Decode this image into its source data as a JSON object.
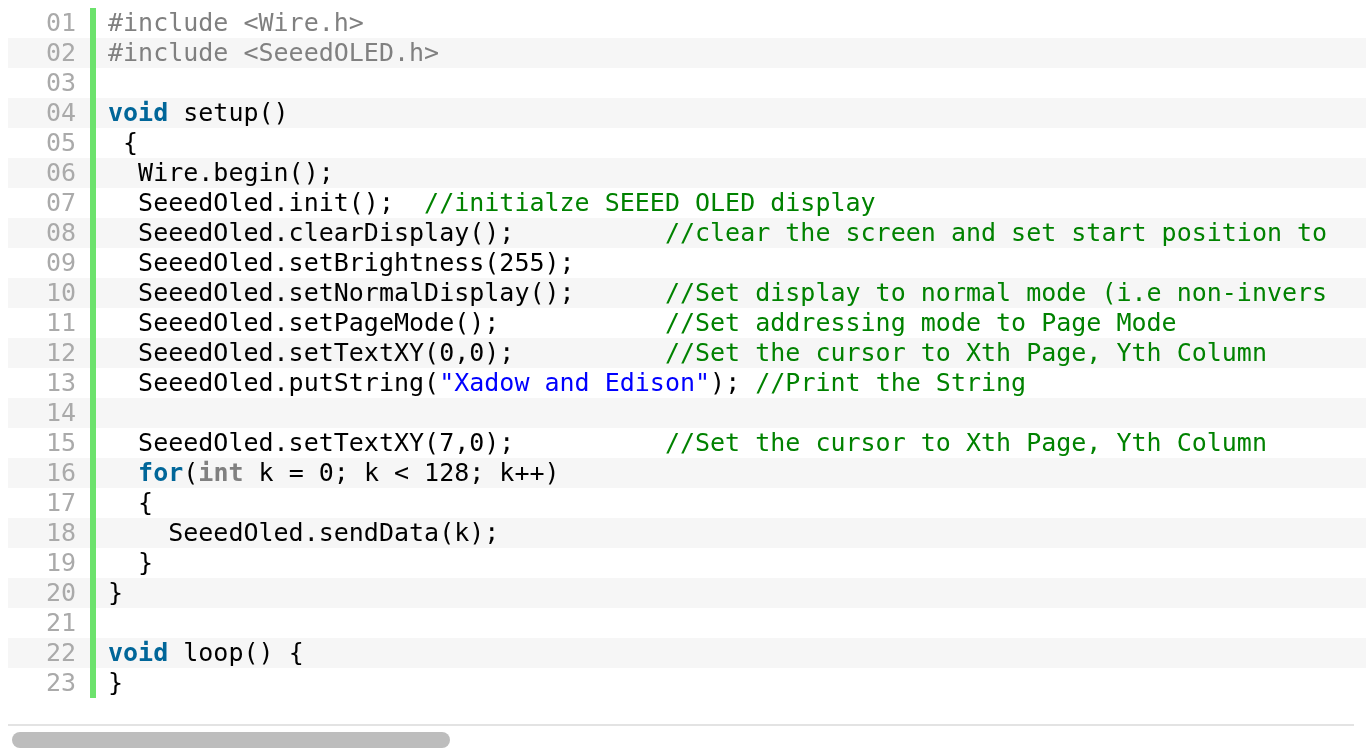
{
  "code_lines": [
    {
      "number": "01",
      "tokens": [
        {
          "kind": "preproc",
          "text": "#include <Wire.h>"
        }
      ]
    },
    {
      "number": "02",
      "tokens": [
        {
          "kind": "preproc",
          "text": "#include <SeeedOLED.h>"
        }
      ]
    },
    {
      "number": "03"
    },
    {
      "number": "04",
      "tokens": [
        {
          "kind": "keyword",
          "text": "void"
        },
        {
          "kind": "plain",
          "text": " setup()"
        }
      ]
    },
    {
      "number": "05",
      "tokens": [
        {
          "kind": "plain",
          "text": " {"
        }
      ]
    },
    {
      "number": "06",
      "tokens": [
        {
          "kind": "plain",
          "text": "  Wire.begin();"
        }
      ]
    },
    {
      "number": "07",
      "tokens": [
        {
          "kind": "plain",
          "text": "  SeeedOled.init();  "
        },
        {
          "kind": "comment",
          "text": "//initialze SEEED OLED display"
        }
      ]
    },
    {
      "number": "08",
      "tokens": [
        {
          "kind": "plain",
          "text": "  SeeedOled.clearDisplay();          "
        },
        {
          "kind": "comment",
          "text": "//clear the screen and set start position to"
        }
      ]
    },
    {
      "number": "09",
      "tokens": [
        {
          "kind": "plain",
          "text": "  SeeedOled.setBrightness(255);"
        }
      ]
    },
    {
      "number": "10",
      "tokens": [
        {
          "kind": "plain",
          "text": "  SeeedOled.setNormalDisplay();      "
        },
        {
          "kind": "comment",
          "text": "//Set display to normal mode (i.e non-invers"
        }
      ]
    },
    {
      "number": "11",
      "tokens": [
        {
          "kind": "plain",
          "text": "  SeeedOled.setPageMode();           "
        },
        {
          "kind": "comment",
          "text": "//Set addressing mode to Page Mode"
        }
      ]
    },
    {
      "number": "12",
      "tokens": [
        {
          "kind": "plain",
          "text": "  SeeedOled.setTextXY(0,0);          "
        },
        {
          "kind": "comment",
          "text": "//Set the cursor to Xth Page, Yth Column"
        }
      ]
    },
    {
      "number": "13",
      "tokens": [
        {
          "kind": "plain",
          "text": "  SeeedOled.putString("
        },
        {
          "kind": "string",
          "text": "\"Xadow and Edison\""
        },
        {
          "kind": "plain",
          "text": "); "
        },
        {
          "kind": "comment",
          "text": "//Print the String"
        }
      ]
    },
    {
      "number": "14"
    },
    {
      "number": "15",
      "tokens": [
        {
          "kind": "plain",
          "text": "  SeeedOled.setTextXY(7,0);          "
        },
        {
          "kind": "comment",
          "text": "//Set the cursor to Xth Page, Yth Column"
        }
      ]
    },
    {
      "number": "16",
      "tokens": [
        {
          "kind": "keyword",
          "text": "  for"
        },
        {
          "kind": "plain",
          "text": "("
        },
        {
          "kind": "type",
          "text": "int"
        },
        {
          "kind": "plain",
          "text": " k = 0; k < 128; k++)"
        }
      ]
    },
    {
      "number": "17",
      "tokens": [
        {
          "kind": "plain",
          "text": "  {"
        }
      ]
    },
    {
      "number": "18",
      "tokens": [
        {
          "kind": "plain",
          "text": "    SeeedOled.sendData(k);"
        }
      ]
    },
    {
      "number": "19",
      "tokens": [
        {
          "kind": "plain",
          "text": "  }"
        }
      ]
    },
    {
      "number": "20",
      "tokens": [
        {
          "kind": "plain",
          "text": "}"
        }
      ]
    },
    {
      "number": "21"
    },
    {
      "number": "22",
      "tokens": [
        {
          "kind": "keyword",
          "text": "void"
        },
        {
          "kind": "plain",
          "text": " loop() {"
        }
      ]
    },
    {
      "number": "23",
      "tokens": [
        {
          "kind": "plain",
          "text": "}"
        }
      ]
    }
  ]
}
